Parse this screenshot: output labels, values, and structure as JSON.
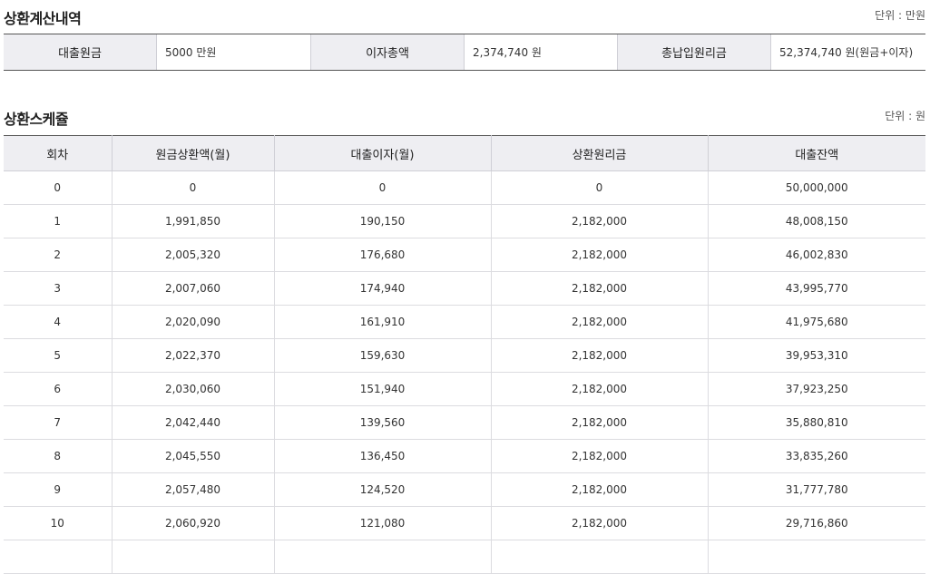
{
  "summary": {
    "title": "상환계산내역",
    "unit": "단위 : 만원",
    "items": [
      {
        "label": "대출원금",
        "value": "5000 만원"
      },
      {
        "label": "이자총액",
        "value": "2,374,740 원"
      },
      {
        "label": "총납입원리금",
        "value": "52,374,740 원(원금+이자)"
      }
    ]
  },
  "schedule": {
    "title": "상환스케쥴",
    "unit": "단위 : 원",
    "headers": [
      "회차",
      "원금상환액(월)",
      "대출이자(월)",
      "상환원리금",
      "대출잔액"
    ],
    "rows": [
      [
        "0",
        "0",
        "0",
        "0",
        "50,000,000"
      ],
      [
        "1",
        "1,991,850",
        "190,150",
        "2,182,000",
        "48,008,150"
      ],
      [
        "2",
        "2,005,320",
        "176,680",
        "2,182,000",
        "46,002,830"
      ],
      [
        "3",
        "2,007,060",
        "174,940",
        "2,182,000",
        "43,995,770"
      ],
      [
        "4",
        "2,020,090",
        "161,910",
        "2,182,000",
        "41,975,680"
      ],
      [
        "5",
        "2,022,370",
        "159,630",
        "2,182,000",
        "39,953,310"
      ],
      [
        "6",
        "2,030,060",
        "151,940",
        "2,182,000",
        "37,923,250"
      ],
      [
        "7",
        "2,042,440",
        "139,560",
        "2,182,000",
        "35,880,810"
      ],
      [
        "8",
        "2,045,550",
        "136,450",
        "2,182,000",
        "33,835,260"
      ],
      [
        "9",
        "2,057,480",
        "124,520",
        "2,182,000",
        "31,777,780"
      ],
      [
        "10",
        "2,060,920",
        "121,080",
        "2,182,000",
        "29,716,860"
      ],
      [
        "",
        "",
        "",
        "",
        ""
      ]
    ]
  }
}
